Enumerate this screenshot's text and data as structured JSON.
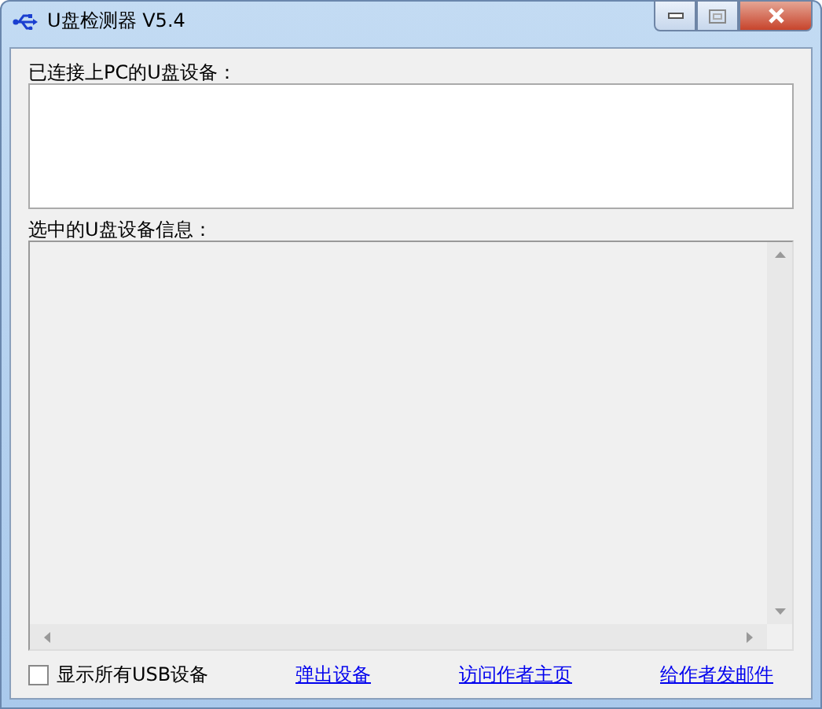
{
  "window": {
    "title": "U盘检测器 V5.4"
  },
  "connected_devices": {
    "label": "已连接上PC的U盘设备："
  },
  "device_info": {
    "label": "选中的U盘设备信息："
  },
  "show_all_usb": {
    "label": "显示所有USB设备",
    "checked": false
  },
  "links": [
    "弹出设备",
    "访问作者主页",
    "给作者发邮件"
  ]
}
